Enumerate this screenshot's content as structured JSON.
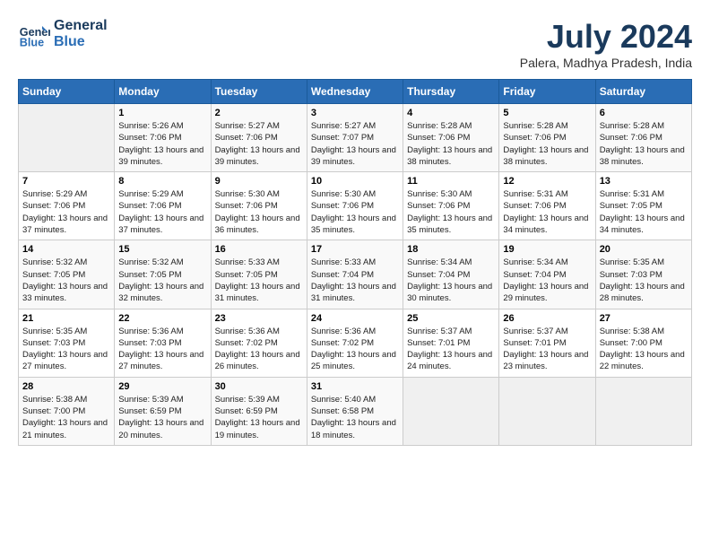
{
  "header": {
    "logo_line1": "General",
    "logo_line2": "Blue",
    "month": "July 2024",
    "location": "Palera, Madhya Pradesh, India"
  },
  "days_of_week": [
    "Sunday",
    "Monday",
    "Tuesday",
    "Wednesday",
    "Thursday",
    "Friday",
    "Saturday"
  ],
  "weeks": [
    [
      {
        "num": "",
        "empty": true
      },
      {
        "num": "1",
        "sunrise": "5:26 AM",
        "sunset": "7:06 PM",
        "daylight": "13 hours and 39 minutes."
      },
      {
        "num": "2",
        "sunrise": "5:27 AM",
        "sunset": "7:06 PM",
        "daylight": "13 hours and 39 minutes."
      },
      {
        "num": "3",
        "sunrise": "5:27 AM",
        "sunset": "7:07 PM",
        "daylight": "13 hours and 39 minutes."
      },
      {
        "num": "4",
        "sunrise": "5:28 AM",
        "sunset": "7:06 PM",
        "daylight": "13 hours and 38 minutes."
      },
      {
        "num": "5",
        "sunrise": "5:28 AM",
        "sunset": "7:06 PM",
        "daylight": "13 hours and 38 minutes."
      },
      {
        "num": "6",
        "sunrise": "5:28 AM",
        "sunset": "7:06 PM",
        "daylight": "13 hours and 38 minutes."
      }
    ],
    [
      {
        "num": "7",
        "sunrise": "5:29 AM",
        "sunset": "7:06 PM",
        "daylight": "13 hours and 37 minutes."
      },
      {
        "num": "8",
        "sunrise": "5:29 AM",
        "sunset": "7:06 PM",
        "daylight": "13 hours and 37 minutes."
      },
      {
        "num": "9",
        "sunrise": "5:30 AM",
        "sunset": "7:06 PM",
        "daylight": "13 hours and 36 minutes."
      },
      {
        "num": "10",
        "sunrise": "5:30 AM",
        "sunset": "7:06 PM",
        "daylight": "13 hours and 35 minutes."
      },
      {
        "num": "11",
        "sunrise": "5:30 AM",
        "sunset": "7:06 PM",
        "daylight": "13 hours and 35 minutes."
      },
      {
        "num": "12",
        "sunrise": "5:31 AM",
        "sunset": "7:06 PM",
        "daylight": "13 hours and 34 minutes."
      },
      {
        "num": "13",
        "sunrise": "5:31 AM",
        "sunset": "7:05 PM",
        "daylight": "13 hours and 34 minutes."
      }
    ],
    [
      {
        "num": "14",
        "sunrise": "5:32 AM",
        "sunset": "7:05 PM",
        "daylight": "13 hours and 33 minutes."
      },
      {
        "num": "15",
        "sunrise": "5:32 AM",
        "sunset": "7:05 PM",
        "daylight": "13 hours and 32 minutes."
      },
      {
        "num": "16",
        "sunrise": "5:33 AM",
        "sunset": "7:05 PM",
        "daylight": "13 hours and 31 minutes."
      },
      {
        "num": "17",
        "sunrise": "5:33 AM",
        "sunset": "7:04 PM",
        "daylight": "13 hours and 31 minutes."
      },
      {
        "num": "18",
        "sunrise": "5:34 AM",
        "sunset": "7:04 PM",
        "daylight": "13 hours and 30 minutes."
      },
      {
        "num": "19",
        "sunrise": "5:34 AM",
        "sunset": "7:04 PM",
        "daylight": "13 hours and 29 minutes."
      },
      {
        "num": "20",
        "sunrise": "5:35 AM",
        "sunset": "7:03 PM",
        "daylight": "13 hours and 28 minutes."
      }
    ],
    [
      {
        "num": "21",
        "sunrise": "5:35 AM",
        "sunset": "7:03 PM",
        "daylight": "13 hours and 27 minutes."
      },
      {
        "num": "22",
        "sunrise": "5:36 AM",
        "sunset": "7:03 PM",
        "daylight": "13 hours and 27 minutes."
      },
      {
        "num": "23",
        "sunrise": "5:36 AM",
        "sunset": "7:02 PM",
        "daylight": "13 hours and 26 minutes."
      },
      {
        "num": "24",
        "sunrise": "5:36 AM",
        "sunset": "7:02 PM",
        "daylight": "13 hours and 25 minutes."
      },
      {
        "num": "25",
        "sunrise": "5:37 AM",
        "sunset": "7:01 PM",
        "daylight": "13 hours and 24 minutes."
      },
      {
        "num": "26",
        "sunrise": "5:37 AM",
        "sunset": "7:01 PM",
        "daylight": "13 hours and 23 minutes."
      },
      {
        "num": "27",
        "sunrise": "5:38 AM",
        "sunset": "7:00 PM",
        "daylight": "13 hours and 22 minutes."
      }
    ],
    [
      {
        "num": "28",
        "sunrise": "5:38 AM",
        "sunset": "7:00 PM",
        "daylight": "13 hours and 21 minutes."
      },
      {
        "num": "29",
        "sunrise": "5:39 AM",
        "sunset": "6:59 PM",
        "daylight": "13 hours and 20 minutes."
      },
      {
        "num": "30",
        "sunrise": "5:39 AM",
        "sunset": "6:59 PM",
        "daylight": "13 hours and 19 minutes."
      },
      {
        "num": "31",
        "sunrise": "5:40 AM",
        "sunset": "6:58 PM",
        "daylight": "13 hours and 18 minutes."
      },
      {
        "num": "",
        "empty": true
      },
      {
        "num": "",
        "empty": true
      },
      {
        "num": "",
        "empty": true
      }
    ]
  ],
  "labels": {
    "sunrise_prefix": "Sunrise: ",
    "sunset_prefix": "Sunset: ",
    "daylight_prefix": "Daylight: "
  }
}
